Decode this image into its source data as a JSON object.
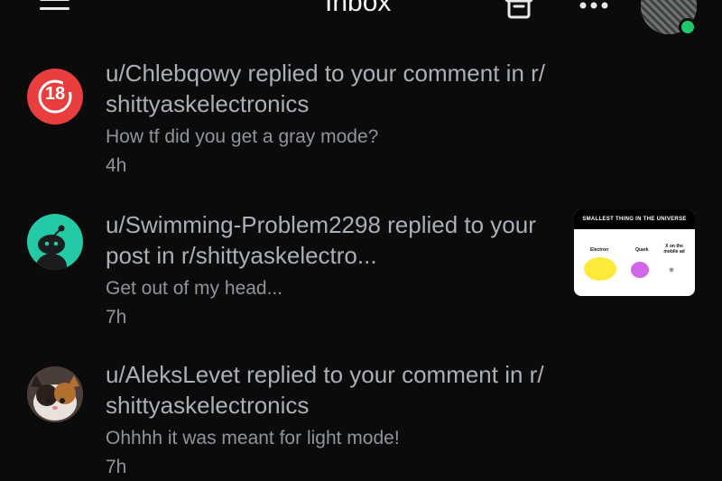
{
  "header": {
    "title": "Inbox",
    "icons": [
      "menu-icon",
      "archive-icon",
      "more-icon",
      "avatar"
    ],
    "online_color": "#1ec96b"
  },
  "inbox": {
    "items": [
      {
        "user": "u/Chlebqowy",
        "headline": "u/Chlebqowy replied to your comment in r/ shittyaskelectronics",
        "snippet": "How tf did you get a gray mode?",
        "time": "4h",
        "badge": "18"
      },
      {
        "user": "u/Swimming-Problem2298",
        "headline": "u/Swimming-Problem2298 replied to your post in r/shittyaskelectro...",
        "snippet": "Get out of my head...",
        "time": "7h",
        "thumbnail": {
          "title": "SMALLEST THING IN THE UNIVERSE",
          "labels": [
            "Electron",
            "Quark",
            "X on the mobile ad"
          ]
        }
      },
      {
        "user": "u/AleksLevet",
        "headline": "u/AleksLevet replied to your comment in r/ shittyaskelectronics",
        "snippet": "Ohhhh it was meant for light mode!",
        "time": "7h"
      }
    ]
  },
  "colors": {
    "background": "#0b0b0c",
    "headline": "#a9b0b7",
    "snippet": "#8e959c",
    "badge_red": "#ea3d3d",
    "snoo_teal": "#24c9a5"
  }
}
